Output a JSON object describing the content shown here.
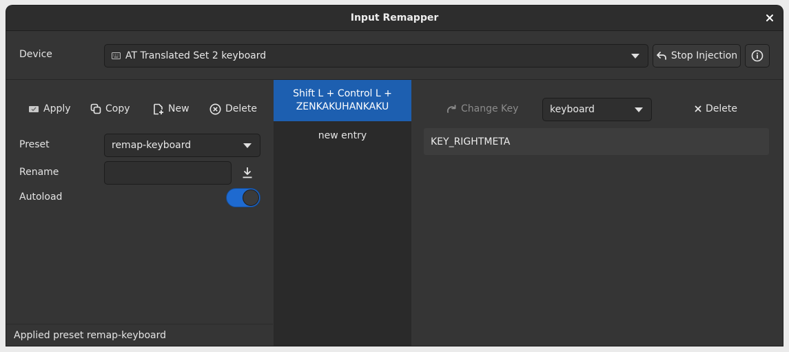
{
  "window": {
    "title": "Input Remapper"
  },
  "device": {
    "label": "Device",
    "selected": "AT Translated Set 2 keyboard",
    "stop_injection_label": "Stop Injection"
  },
  "preset_toolbar": {
    "apply_label": "Apply",
    "copy_label": "Copy",
    "new_label": "New",
    "delete_label": "Delete"
  },
  "preset": {
    "label": "Preset",
    "selected": "remap-keyboard",
    "rename_label": "Rename",
    "rename_value": "",
    "autoload_label": "Autoload",
    "autoload_on": true
  },
  "mapping_list": {
    "entries": [
      {
        "line1": "Shift L + Control L +",
        "line2": "ZENKAKUHANKAKU",
        "selected": true
      },
      {
        "line1": "new entry",
        "selected": false
      }
    ]
  },
  "editor": {
    "change_key_label": "Change Key",
    "target_selected": "keyboard",
    "delete_label": "Delete",
    "output_symbol": "KEY_RIGHTMETA"
  },
  "status": {
    "text": "Applied preset remap-keyboard"
  },
  "colors": {
    "accent": "#1d5fb0",
    "toggle_on": "#1e6ad0",
    "background": "#353535"
  }
}
